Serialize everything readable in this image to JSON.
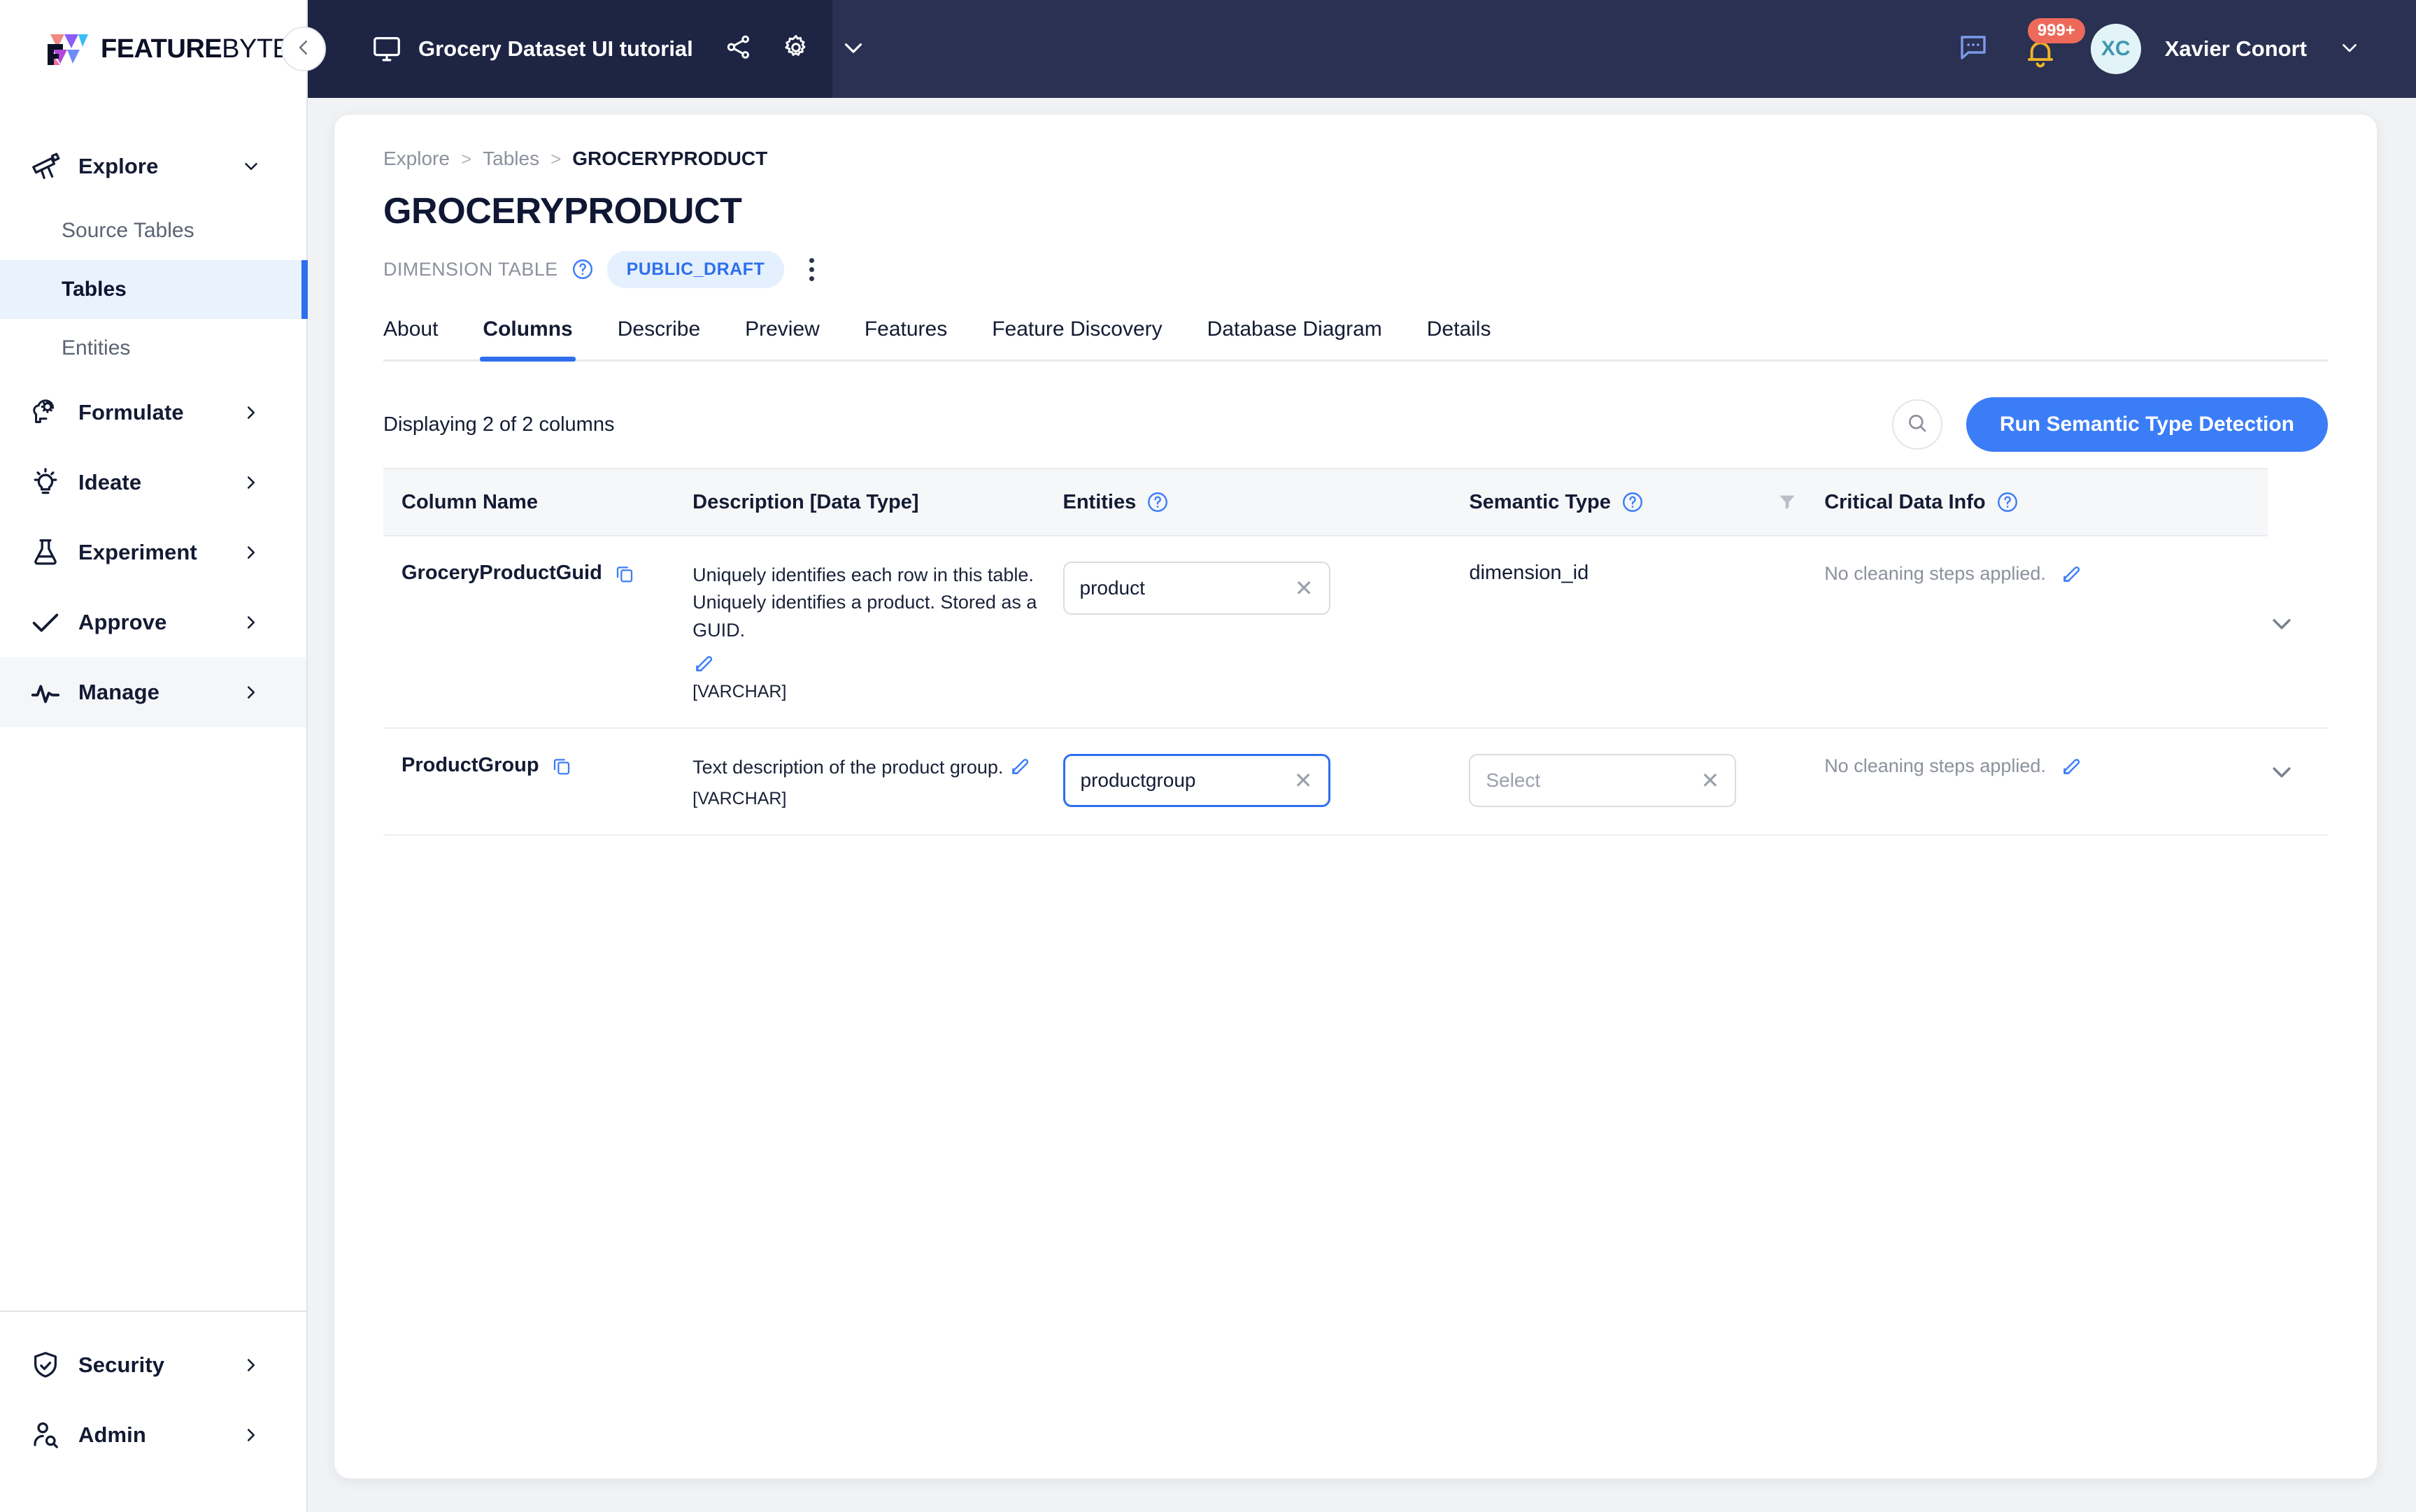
{
  "brand": {
    "name_bold": "FEATURE",
    "name_thin": "BYTE"
  },
  "topbar": {
    "workspace_title": "Grocery Dataset UI tutorial",
    "share_icon": "share-icon",
    "settings_icon": "gear-icon",
    "workspace_chevron_icon": "chevron-down-icon",
    "collapse_icon": "chevron-left-icon",
    "chat_icon": "chat-bubble-icon",
    "bell_icon": "bell-icon",
    "notification_count": "999+",
    "avatar_initials": "XC",
    "user_name": "Xavier Conort",
    "user_chevron_icon": "chevron-down-icon"
  },
  "sidebar": {
    "groups": [
      {
        "label": "Explore",
        "icon": "telescope-icon",
        "chevron": "chevron-down-icon",
        "expanded": true
      },
      {
        "label": "Formulate",
        "icon": "brain-gear-icon",
        "chevron": "chevron-right-icon",
        "expanded": false
      },
      {
        "label": "Ideate",
        "icon": "lightbulb-icon",
        "chevron": "chevron-right-icon",
        "expanded": false
      },
      {
        "label": "Experiment",
        "icon": "flask-icon",
        "chevron": "chevron-right-icon",
        "expanded": false
      },
      {
        "label": "Approve",
        "icon": "check-icon",
        "chevron": "chevron-right-icon",
        "expanded": false
      },
      {
        "label": "Manage",
        "icon": "activity-pulse-icon",
        "chevron": "chevron-right-icon",
        "expanded": false
      }
    ],
    "explore_children": [
      {
        "label": "Source Tables",
        "selected": false
      },
      {
        "label": "Tables",
        "selected": true
      },
      {
        "label": "Entities",
        "selected": false
      }
    ],
    "bottom": [
      {
        "label": "Security",
        "icon": "shield-check-icon",
        "chevron": "chevron-right-icon"
      },
      {
        "label": "Admin",
        "icon": "user-search-icon",
        "chevron": "chevron-right-icon"
      }
    ]
  },
  "breadcrumb": {
    "items": [
      "Explore",
      "Tables"
    ],
    "current": "GROCERYPRODUCT",
    "separator": ">"
  },
  "page": {
    "title": "GROCERYPRODUCT",
    "subtype_label": "DIMENSION TABLE",
    "subtype_help_icon": "question-circle-icon",
    "status_badge": "PUBLIC_DRAFT",
    "kebab_icon": "more-vertical-icon"
  },
  "tabs": [
    {
      "label": "About",
      "active": false
    },
    {
      "label": "Columns",
      "active": true
    },
    {
      "label": "Describe",
      "active": false
    },
    {
      "label": "Preview",
      "active": false
    },
    {
      "label": "Features",
      "active": false
    },
    {
      "label": "Feature Discovery",
      "active": false
    },
    {
      "label": "Database Diagram",
      "active": false
    },
    {
      "label": "Details",
      "active": false
    }
  ],
  "toolbar": {
    "displaying": "Displaying 2 of 2 columns",
    "search_icon": "search-icon",
    "run_detection_label": "Run Semantic Type Detection"
  },
  "table": {
    "headers": [
      {
        "label": "Column Name",
        "help": false
      },
      {
        "label": "Description [Data Type]",
        "help": false
      },
      {
        "label": "Entities",
        "help": true,
        "help_icon": "question-circle-icon"
      },
      {
        "label": "Semantic Type",
        "help": true,
        "help_icon": "question-circle-icon",
        "filter_icon": "filter-icon"
      },
      {
        "label": "Critical Data Info",
        "help": true,
        "help_icon": "question-circle-icon"
      }
    ],
    "rows": [
      {
        "name": "GroceryProductGuid",
        "copy_icon": "copy-icon",
        "description": "Uniquely identifies each row in this table. Uniquely identifies a product. Stored as a GUID.",
        "description_edit_icon": "pencil-edit-icon",
        "data_type": "[VARCHAR]",
        "entity_value": "product",
        "entity_clear": "✕",
        "entity_focused": false,
        "semantic_type": "dimension_id",
        "semantic_is_input": false,
        "critical_data_info": "No cleaning steps applied.",
        "critical_edit_icon": "pencil-edit-icon",
        "expand_icon": "chevron-down-icon"
      },
      {
        "name": "ProductGroup",
        "copy_icon": "copy-icon",
        "description": "Text description of the product group.",
        "description_edit_icon": "pencil-edit-icon",
        "data_type": "[VARCHAR]",
        "entity_value": "productgroup",
        "entity_clear": "✕",
        "entity_focused": true,
        "semantic_type": "",
        "semantic_placeholder": "Select",
        "semantic_clear": "✕",
        "semantic_is_input": true,
        "critical_data_info": "No cleaning steps applied.",
        "critical_edit_icon": "pencil-edit-icon",
        "expand_icon": "chevron-down-icon"
      }
    ]
  },
  "colors": {
    "topbar_bg": "#2a3152",
    "topbar_left_bg": "#1d2444",
    "accent_blue": "#2f6fed",
    "primary_button": "#3b7df7",
    "badge_bg": "#e4f0fd",
    "notification_red": "#ed6a5a",
    "avatar_bg": "#e3f4f8",
    "avatar_fg": "#3e97ad",
    "page_bg": "#f1f2f4",
    "sidebar_selected_bg": "#e9f2fd"
  }
}
